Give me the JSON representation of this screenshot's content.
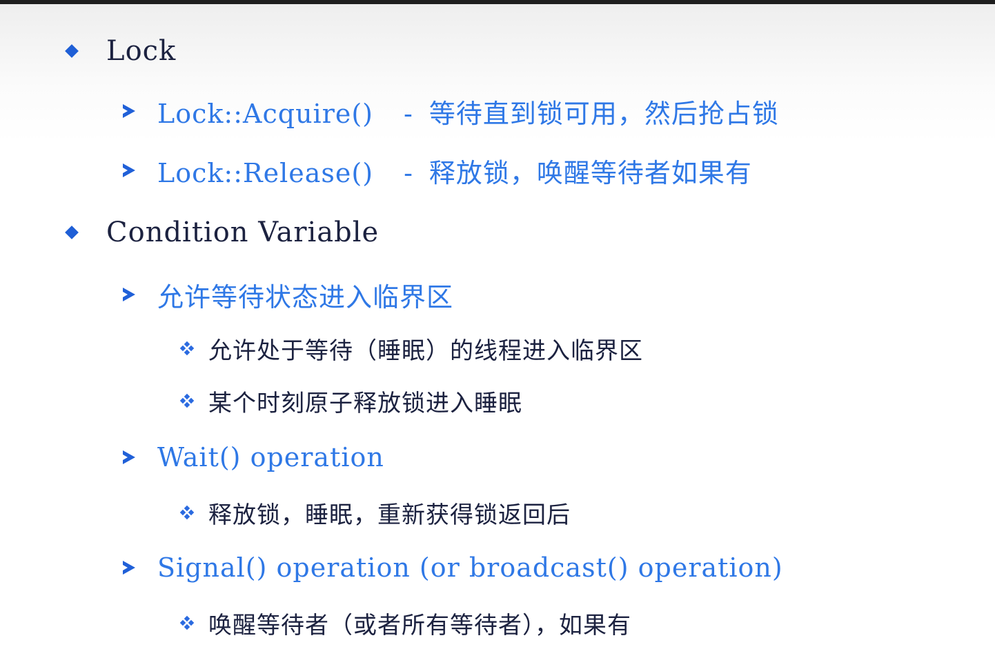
{
  "slide": {
    "items": [
      {
        "level": 1,
        "text": "Lock"
      },
      {
        "level": 2,
        "code": "Lock::Acquire()",
        "dash": "-",
        "desc": "等待直到锁可用，然后抢占锁"
      },
      {
        "level": 2,
        "code": "Lock::Release()",
        "dash": "-",
        "desc": "释放锁，唤醒等待者如果有"
      },
      {
        "level": 1,
        "text": "Condition Variable"
      },
      {
        "level": 2,
        "text": "允许等待状态进入临界区"
      },
      {
        "level": 3,
        "text": "允许处于等待（睡眠）的线程进入临界区"
      },
      {
        "level": 3,
        "text": "某个时刻原子释放锁进入睡眠"
      },
      {
        "level": 2,
        "text": "Wait() operation"
      },
      {
        "level": 3,
        "text": "释放锁，睡眠，重新获得锁返回后"
      },
      {
        "level": 2,
        "text": "Signal() operation (or broadcast() operation)"
      },
      {
        "level": 3,
        "text": "唤醒等待者（或者所有等待者），如果有"
      }
    ]
  },
  "colors": {
    "level1_text": "#1c2240",
    "level2_text": "#2f78e6",
    "bullet_blue": "#1f5fd6"
  }
}
